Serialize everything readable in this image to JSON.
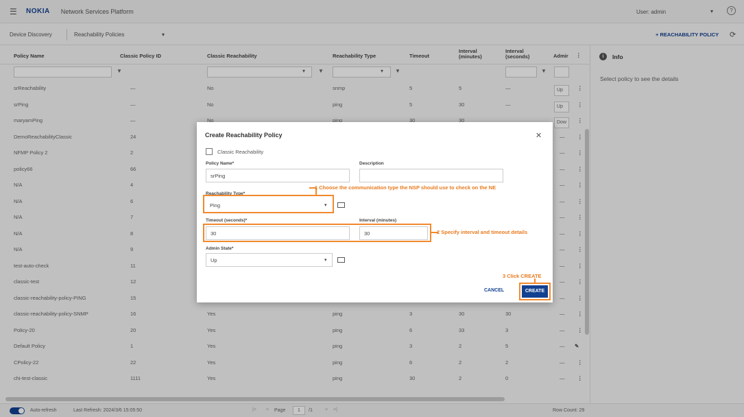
{
  "header": {
    "app_logo": "NOKIA",
    "app_title": "Network Services Platform",
    "user": "User: admin"
  },
  "subbar": {
    "tab1": "Device Discovery",
    "tab2": "Reachability Policies",
    "add_button": "+ REACHABILITY POLICY"
  },
  "grid": {
    "headers": [
      "Policy Name",
      "Classic Policy ID",
      "Classic Reachability",
      "Reachability Type",
      "Timeout",
      "Interval (minutes)",
      "Interval (seconds)",
      "Admir"
    ],
    "rows": [
      [
        "srReachability",
        "—",
        "No",
        "snmp",
        "5",
        "5",
        "—",
        "Up"
      ],
      [
        "srPing",
        "—",
        "No",
        "ping",
        "5",
        "30",
        "—",
        "Up"
      ],
      [
        "maryamPing",
        "—",
        "No",
        "ping",
        "30",
        "30",
        "",
        "Dow"
      ],
      [
        "DemoReachabilityClassic",
        "24",
        "",
        "",
        "",
        "",
        "",
        "—"
      ],
      [
        "NFMP Policy 2",
        "2",
        "",
        "",
        "",
        "",
        "",
        "—"
      ],
      [
        "policy66",
        "66",
        "",
        "",
        "",
        "",
        "",
        "—"
      ],
      [
        "N/A",
        "4",
        "",
        "",
        "",
        "",
        "",
        "—"
      ],
      [
        "N/A",
        "6",
        "",
        "",
        "",
        "",
        "",
        "—"
      ],
      [
        "N/A",
        "7",
        "",
        "",
        "",
        "",
        "",
        "—"
      ],
      [
        "N/A",
        "8",
        "",
        "",
        "",
        "",
        "",
        "—"
      ],
      [
        "N/A",
        "9",
        "",
        "",
        "",
        "",
        "",
        "—"
      ],
      [
        "test-auto-check",
        "11",
        "",
        "",
        "",
        "",
        "",
        "—"
      ],
      [
        "classic-test",
        "12",
        "",
        "",
        "",
        "",
        "",
        "—"
      ],
      [
        "classic-reachability-policy-PING",
        "15",
        "",
        "",
        "",
        "",
        "",
        "—"
      ],
      [
        "classic-reachability-policy-SNMP",
        "16",
        "Yes",
        "ping",
        "3",
        "30",
        "30",
        "—"
      ],
      [
        "Policy-20",
        "20",
        "Yes",
        "ping",
        "6",
        "33",
        "3",
        "—"
      ],
      [
        "Default Policy",
        "1",
        "Yes",
        "ping",
        "3",
        "2",
        "5",
        "—"
      ],
      [
        "CPolicy-22",
        "22",
        "Yes",
        "ping",
        "6",
        "2",
        "2",
        "—"
      ],
      [
        "chi-test-classic",
        "1111",
        "Yes",
        "ping",
        "30",
        "2",
        "0",
        "—"
      ]
    ]
  },
  "info_panel": {
    "title": "Info",
    "text": "Select policy to see the details"
  },
  "footer": {
    "auto_refresh": "Auto-refresh",
    "last_refresh": "Last Refresh: 2024/3/6 15:05:50",
    "page_label": "Page",
    "page_value": "1",
    "page_total": "/1",
    "row_count": "Row Count: 29"
  },
  "modal": {
    "title": "Create Reachability Policy",
    "classic_label": "Classic Reachability",
    "policy_name_label": "Policy Name*",
    "policy_name_value": "srPing",
    "description_label": "Description",
    "reach_type_label": "Reachability Type*",
    "reach_type_value": "Ping",
    "timeout_label": "Timeout (seconds)*",
    "timeout_value": "30",
    "interval_label": "Interval (minutes)",
    "interval_value": "30",
    "admin_label": "Admin State*",
    "admin_value": "Up",
    "cancel": "CANCEL",
    "create": "CREATE"
  },
  "callouts": {
    "c1": "1 Choose the communication type the NSP should use to check on the NE",
    "c2": "2 Specify interval and timeout details",
    "c3": "3 Click CREATE"
  },
  "colors": {
    "brand": "#124191",
    "callout": "#f2892c"
  }
}
